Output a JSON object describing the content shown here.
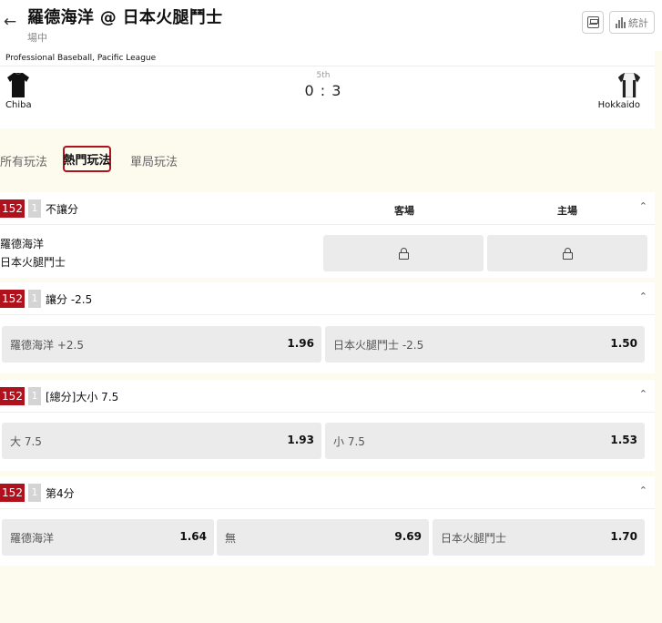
{
  "header": {
    "title": "羅德海洋 @ 日本火腿鬥士",
    "status": "場中",
    "stats_label": "統計"
  },
  "match": {
    "league": "Professional Baseball, Pacific League",
    "inning": "5th",
    "score": "0 : 3",
    "home_team": "Chiba",
    "away_team": "Hokkaido"
  },
  "tabs": [
    "所有玩法",
    "熱門玩法",
    "單局玩法"
  ],
  "markets": [
    {
      "badge": "152",
      "count": "1",
      "title": "不讓分",
      "col_away": "客場",
      "col_home": "主場",
      "team_a": "羅德海洋",
      "team_b": "日本火腿鬥士"
    },
    {
      "badge": "152",
      "count": "1",
      "title": "讓分 -2.5",
      "options": [
        {
          "label": "羅德海洋 +2.5",
          "odds": "1.96"
        },
        {
          "label": "日本火腿鬥士 -2.5",
          "odds": "1.50"
        }
      ]
    },
    {
      "badge": "152",
      "count": "1",
      "title": "[總分]大小 7.5",
      "options": [
        {
          "label": "大 7.5",
          "odds": "1.93"
        },
        {
          "label": "小 7.5",
          "odds": "1.53"
        }
      ]
    },
    {
      "badge": "152",
      "count": "1",
      "title": "第4分",
      "options": [
        {
          "label": "羅德海洋",
          "odds": "1.64"
        },
        {
          "label": "無",
          "odds": "9.69"
        },
        {
          "label": "日本火腿鬥士",
          "odds": "1.70"
        }
      ]
    }
  ],
  "colors": {
    "accent": "#b0121d",
    "page_bg": "#fdfbee",
    "button_bg": "#ebebeb"
  },
  "icons": [
    "back-arrow-icon",
    "scoreboard-icon",
    "bar-chart-icon",
    "lock-icon",
    "chevron-up-icon",
    "jersey-icon"
  ]
}
